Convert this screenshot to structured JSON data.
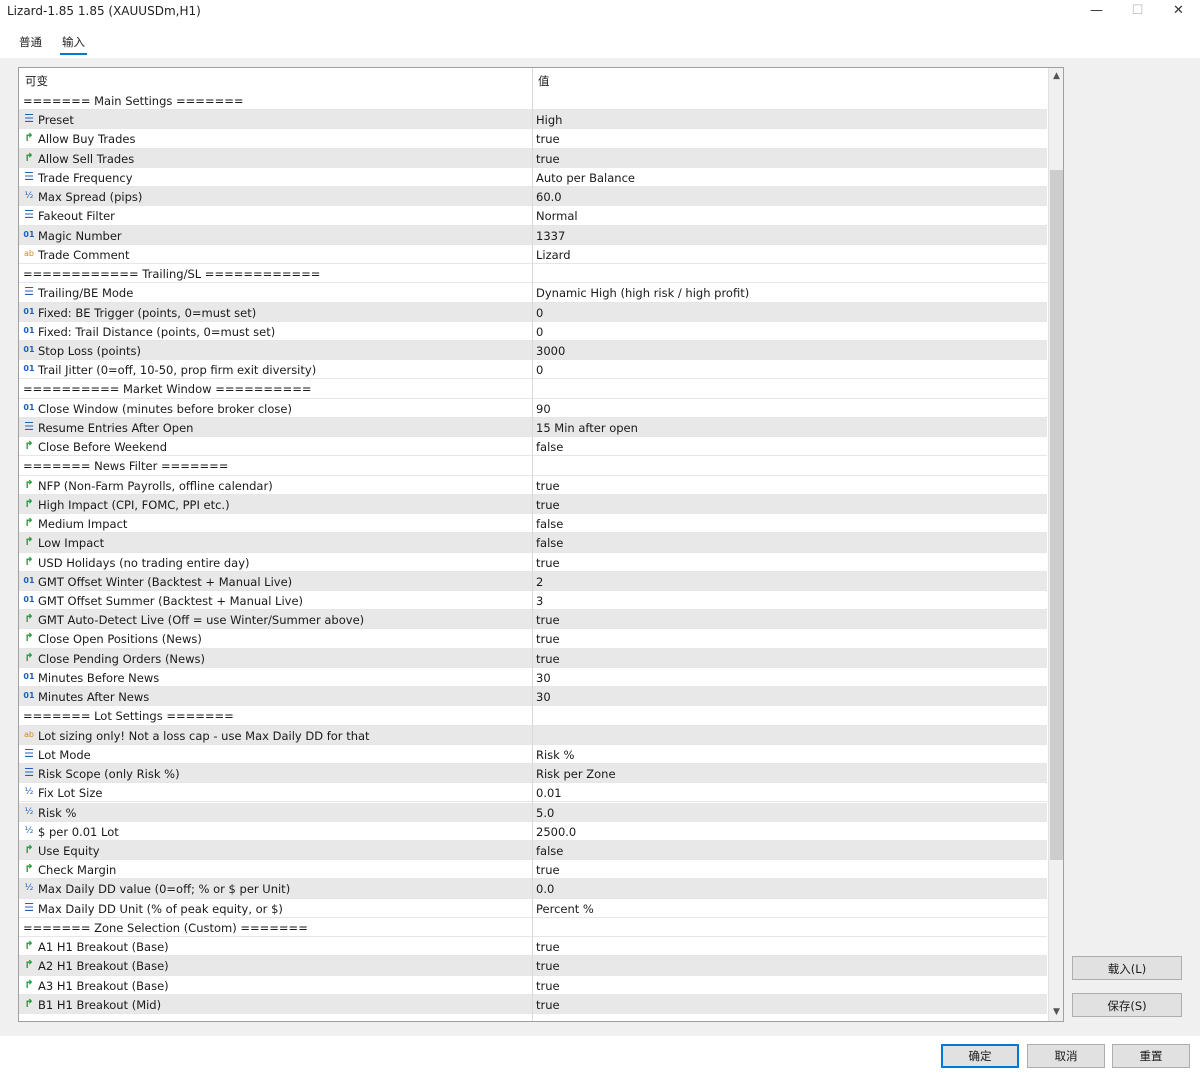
{
  "window": {
    "title": "Lizard-1.85 1.85 (XAUUSDm,H1)",
    "minimize": "—",
    "maximize": "☐",
    "close": "✕"
  },
  "tabs": [
    {
      "label": "普通"
    },
    {
      "label": "输入",
      "active": true
    }
  ],
  "table": {
    "col_name": "可变",
    "col_value": "值",
    "rows": [
      {
        "type": "sep",
        "name": "======= Main Settings =======",
        "value": ""
      },
      {
        "type": "enum",
        "name": "Preset",
        "value": "High"
      },
      {
        "type": "bool",
        "name": "Allow Buy Trades",
        "value": "true"
      },
      {
        "type": "bool",
        "name": "Allow Sell Trades",
        "value": "true"
      },
      {
        "type": "enum",
        "name": "Trade Frequency",
        "value": "Auto per Balance"
      },
      {
        "type": "double",
        "name": "Max Spread (pips)",
        "value": "60.0"
      },
      {
        "type": "enum",
        "name": "Fakeout Filter",
        "value": "Normal"
      },
      {
        "type": "int",
        "name": "Magic Number",
        "value": "1337"
      },
      {
        "type": "str",
        "name": "Trade Comment",
        "value": "Lizard"
      },
      {
        "type": "sep",
        "name": "============ Trailing/SL ============",
        "value": ""
      },
      {
        "type": "enum",
        "name": "Trailing/BE Mode",
        "value": "Dynamic High (high risk / high profit)"
      },
      {
        "type": "int",
        "name": "Fixed: BE Trigger (points, 0=must set)",
        "value": "0"
      },
      {
        "type": "int",
        "name": "Fixed: Trail Distance (points, 0=must set)",
        "value": "0"
      },
      {
        "type": "int",
        "name": "Stop Loss (points)",
        "value": "3000"
      },
      {
        "type": "int",
        "name": "Trail Jitter (0=off, 10-50, prop firm exit diversity)",
        "value": "0"
      },
      {
        "type": "sep",
        "name": "========== Market Window ==========",
        "value": ""
      },
      {
        "type": "int",
        "name": "Close Window (minutes before broker close)",
        "value": "90"
      },
      {
        "type": "enum",
        "name": "Resume Entries After Open",
        "value": "15 Min after open"
      },
      {
        "type": "bool",
        "name": "Close Before Weekend",
        "value": "false"
      },
      {
        "type": "sep",
        "name": "======= News Filter =======",
        "value": ""
      },
      {
        "type": "bool",
        "name": "NFP (Non-Farm Payrolls, offline calendar)",
        "value": "true"
      },
      {
        "type": "bool",
        "name": "High Impact (CPI, FOMC, PPI etc.)",
        "value": "true"
      },
      {
        "type": "bool",
        "name": "Medium Impact",
        "value": "false"
      },
      {
        "type": "bool",
        "name": "Low Impact",
        "value": "false"
      },
      {
        "type": "bool",
        "name": "USD Holidays (no trading entire day)",
        "value": "true"
      },
      {
        "type": "int",
        "name": "GMT Offset Winter (Backtest + Manual Live)",
        "value": "2"
      },
      {
        "type": "int",
        "name": "GMT Offset Summer (Backtest + Manual Live)",
        "value": "3"
      },
      {
        "type": "bool",
        "name": "GMT Auto-Detect Live (Off = use Winter/Summer above)",
        "value": "true"
      },
      {
        "type": "bool",
        "name": "Close Open Positions (News)",
        "value": "true"
      },
      {
        "type": "bool",
        "name": "Close Pending Orders (News)",
        "value": "true"
      },
      {
        "type": "int",
        "name": "Minutes Before News",
        "value": "30"
      },
      {
        "type": "int",
        "name": "Minutes After News",
        "value": "30"
      },
      {
        "type": "sep",
        "name": "======= Lot Settings =======",
        "value": ""
      },
      {
        "type": "str",
        "name": "Lot sizing only! Not a loss cap - use Max Daily DD for that",
        "value": ""
      },
      {
        "type": "enum",
        "name": "Lot Mode",
        "value": "Risk %"
      },
      {
        "type": "enum",
        "name": "Risk Scope (only Risk %)",
        "value": "Risk per Zone"
      },
      {
        "type": "double",
        "name": "Fix Lot Size",
        "value": "0.01"
      },
      {
        "type": "double",
        "name": "Risk %",
        "value": "5.0"
      },
      {
        "type": "double",
        "name": "$ per 0.01 Lot",
        "value": "2500.0"
      },
      {
        "type": "bool",
        "name": "Use Equity",
        "value": "false"
      },
      {
        "type": "bool",
        "name": "Check Margin",
        "value": "true"
      },
      {
        "type": "double",
        "name": "Max Daily DD value (0=off; % or $ per Unit)",
        "value": "0.0"
      },
      {
        "type": "enum",
        "name": "Max Daily DD Unit (% of peak equity, or $)",
        "value": "Percent %"
      },
      {
        "type": "sep",
        "name": "======= Zone Selection (Custom) =======",
        "value": ""
      },
      {
        "type": "bool",
        "name": "A1 H1 Breakout (Base)",
        "value": "true"
      },
      {
        "type": "bool",
        "name": "A2 H1 Breakout (Base)",
        "value": "true"
      },
      {
        "type": "bool",
        "name": "A3 H1 Breakout (Base)",
        "value": "true"
      },
      {
        "type": "bool",
        "name": "B1 H1 Breakout (Mid)",
        "value": "true"
      }
    ]
  },
  "icons": {
    "enum": "☰",
    "bool": "↱",
    "double": "½",
    "int": "01",
    "str": "ab"
  },
  "buttons": {
    "load": "载入(L)",
    "save": "保存(S)",
    "ok": "确定",
    "cancel": "取消",
    "reset": "重置"
  },
  "colors": {
    "accent": "#0078d7",
    "row_alt": "#e8e8e8"
  }
}
